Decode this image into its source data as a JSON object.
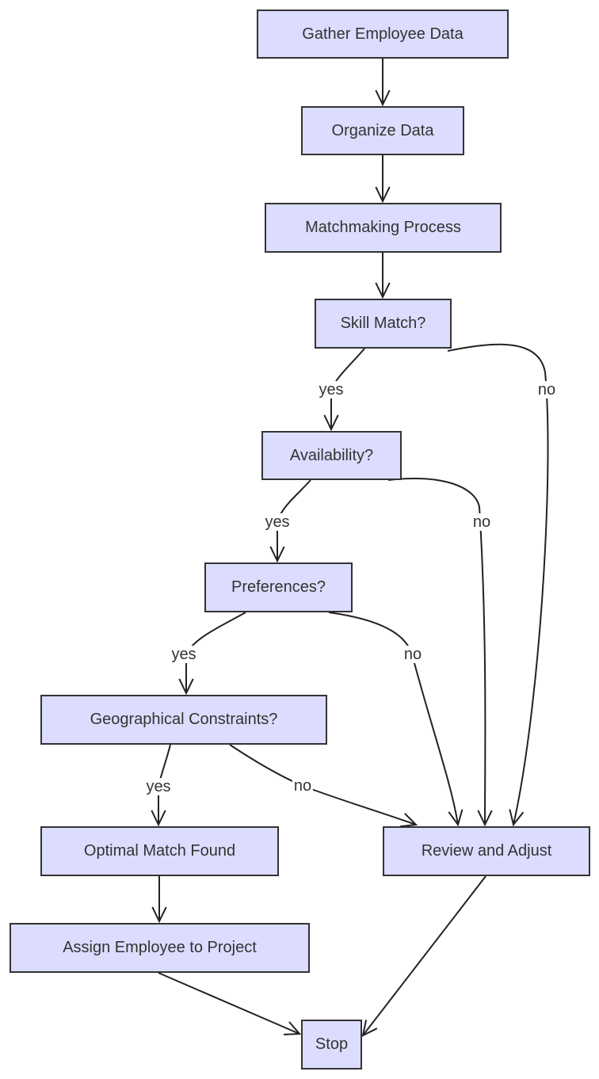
{
  "colors": {
    "node_fill": "#dcdcff",
    "node_border": "#333333",
    "edge": "#222222",
    "text": "#333333"
  },
  "nodes": [
    {
      "id": "gather",
      "label": "Gather Employee Data"
    },
    {
      "id": "organize",
      "label": "Organize Data"
    },
    {
      "id": "matchmaking",
      "label": "Matchmaking Process"
    },
    {
      "id": "skill",
      "label": "Skill Match?"
    },
    {
      "id": "availability",
      "label": "Availability?"
    },
    {
      "id": "preferences",
      "label": "Preferences?"
    },
    {
      "id": "geo",
      "label": "Geographical Constraints?"
    },
    {
      "id": "optimal",
      "label": "Optimal Match Found"
    },
    {
      "id": "review",
      "label": "Review and Adjust"
    },
    {
      "id": "assign",
      "label": "Assign Employee to Project"
    },
    {
      "id": "stop",
      "label": "Stop"
    }
  ],
  "edges": [
    {
      "from": "gather",
      "to": "organize",
      "label": ""
    },
    {
      "from": "organize",
      "to": "matchmaking",
      "label": ""
    },
    {
      "from": "matchmaking",
      "to": "skill",
      "label": ""
    },
    {
      "from": "skill",
      "to": "availability",
      "label": "yes"
    },
    {
      "from": "skill",
      "to": "review",
      "label": "no"
    },
    {
      "from": "availability",
      "to": "preferences",
      "label": "yes"
    },
    {
      "from": "availability",
      "to": "review",
      "label": "no"
    },
    {
      "from": "preferences",
      "to": "geo",
      "label": "yes"
    },
    {
      "from": "preferences",
      "to": "review",
      "label": "no"
    },
    {
      "from": "geo",
      "to": "optimal",
      "label": "yes"
    },
    {
      "from": "geo",
      "to": "review",
      "label": "no"
    },
    {
      "from": "optimal",
      "to": "assign",
      "label": ""
    },
    {
      "from": "assign",
      "to": "stop",
      "label": ""
    },
    {
      "from": "review",
      "to": "stop",
      "label": ""
    }
  ]
}
